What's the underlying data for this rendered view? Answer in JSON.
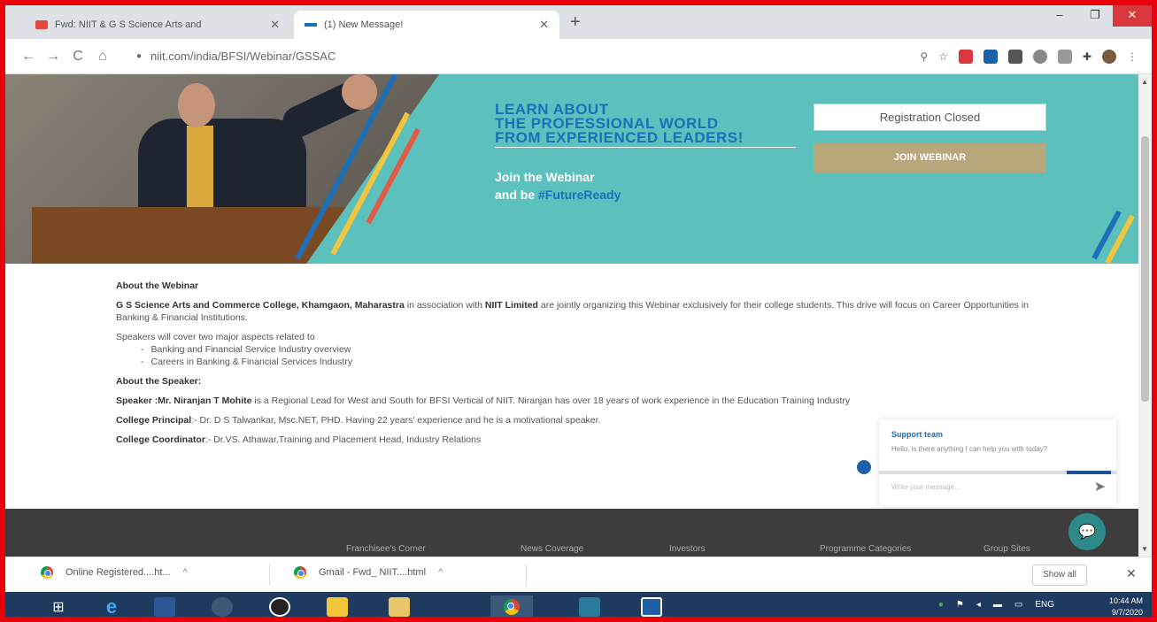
{
  "browser": {
    "tabs": [
      {
        "label": "Fwd: NIIT & G S Science Arts and",
        "state": "inactive"
      },
      {
        "label": "(1) New Message!",
        "state": "active"
      }
    ],
    "new_tab_glyph": "+",
    "window_controls": [
      "–",
      "❐",
      "✕"
    ],
    "url": "niit.com/india/BFSI/Webinar/GSSAC",
    "nav": {
      "back": "←",
      "forward": "→",
      "reload": "C",
      "home": "⌂"
    },
    "toolbar_icons": [
      "search-icon",
      "star-icon",
      "extension-icons",
      "puzzle-icon",
      "profile-icon",
      "menu-icon"
    ]
  },
  "banner": {
    "headline": [
      "LEARN ABOUT",
      "THE PROFESSIONAL WORLD",
      "FROM EXPERIENCED LEADERS!"
    ],
    "subline_1": "Join the Webinar",
    "subline_2_prefix": "and be ",
    "subline_2_hashtag": "#FutureReady",
    "registration_status": "Registration Closed",
    "join_button": "JOIN WEBINAR",
    "colors": {
      "teal": "#5cc1bd",
      "headline_blue": "#1d6fb8",
      "join_bg": "#b8a77a"
    }
  },
  "content": {
    "about_webinar_heading": "About the Webinar",
    "intro_org": "G S Science Arts and Commerce College, Khamgaon, Maharastra",
    "intro_mid": " in association with ",
    "intro_partner": "NIIT Limited",
    "intro_rest": " are jointly organizing this Webinar exclusively for their college students. This drive will focus on Career Opportunities in Banking & Financial Institutions.",
    "speakers_intro": "Speakers will cover two major aspects related to",
    "topics": [
      "Banking and Financial Service Industry overview",
      "Careers in Banking & Financial Services Industry"
    ],
    "about_speaker_heading": "About the Speaker:",
    "speaker_label": "Speaker :",
    "speaker_name": "Mr. Niranjan T Mohite",
    "speaker_desc": " is a Regional Lead for West and South for BFSI Vertical of NIIT. Niranjan has over 18 years of work experience in the Education Training Industry",
    "principal_label": "College Principal",
    "principal_desc": ":- Dr. D S Talwankar, Msc.NET, PHD. Having 22 years' experience and he is a motivational speaker.",
    "coordinator_label": "College Coordinator",
    "coordinator_desc": ":- Dr.VS. Athawar,Training and Placement Head, Industry Relations"
  },
  "support_widget": {
    "title": "Support team",
    "message": "Hello, is there anything I can help you with today?",
    "input_placeholder": "Write your message...",
    "send_glyph": "➤"
  },
  "footer": {
    "links": [
      "Franchisee's Corner",
      "News Coverage",
      "Investors",
      "Programme Categories",
      "Group Sites"
    ]
  },
  "downloads": {
    "items": [
      "Online Registered....ht...",
      "Gmail - Fwd_ NIIT....html"
    ],
    "caret": "^",
    "show_all": "Show all",
    "close_glyph": "✕"
  },
  "taskbar": {
    "language": "ENG",
    "time": "10:44 AM",
    "date": "9/7/2020"
  }
}
